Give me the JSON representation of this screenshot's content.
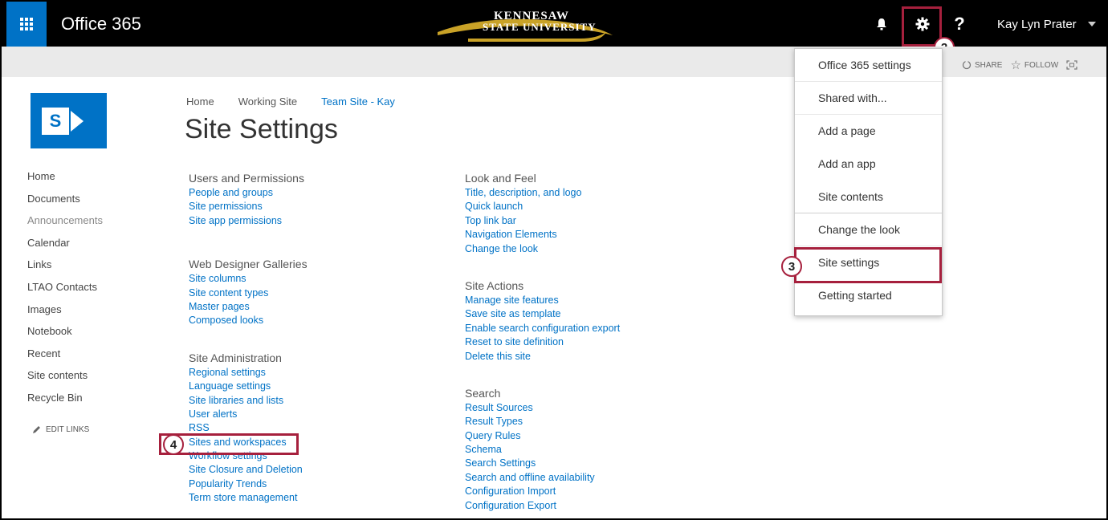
{
  "suitebar": {
    "brand": "Office 365",
    "logo_line1": "KENNESAW",
    "logo_line2": "STATE UNIVERSITY",
    "user_name": "Kay Lyn Prater"
  },
  "subbar": {
    "share": "SHARE",
    "follow": "FOLLOW"
  },
  "breadcrumb": [
    "Home",
    "Working Site",
    "Team Site - Kay"
  ],
  "page_title": "Site Settings",
  "leftnav": {
    "items": [
      "Home",
      "Documents",
      "Announcements",
      "Calendar",
      "Links",
      "LTAO Contacts",
      "Images",
      "Notebook",
      "Recent",
      "Site contents",
      "Recycle Bin"
    ],
    "edit_links": "EDIT LINKS"
  },
  "col1": {
    "users": {
      "heading": "Users and Permissions",
      "links": [
        "People and groups",
        "Site permissions",
        "Site app permissions"
      ]
    },
    "galleries": {
      "heading": "Web Designer Galleries",
      "links": [
        "Site columns",
        "Site content types",
        "Master pages",
        "Composed looks"
      ]
    },
    "admin": {
      "heading": "Site Administration",
      "links": [
        "Regional settings",
        "Language settings",
        "Site libraries and lists",
        "User alerts",
        "RSS",
        "Sites and workspaces",
        "Workflow settings",
        "Site Closure and Deletion",
        "Popularity Trends",
        "Term store management"
      ]
    }
  },
  "col2": {
    "look": {
      "heading": "Look and Feel",
      "links": [
        "Title, description, and logo",
        "Quick launch",
        "Top link bar",
        "Navigation Elements",
        "Change the look"
      ]
    },
    "actions": {
      "heading": "Site Actions",
      "links": [
        "Manage site features",
        "Save site as template",
        "Enable search configuration export",
        "Reset to site definition",
        "Delete this site"
      ]
    },
    "search": {
      "heading": "Search",
      "links": [
        "Result Sources",
        "Result Types",
        "Query Rules",
        "Schema",
        "Search Settings",
        "Search and offline availability",
        "Configuration Import",
        "Configuration Export"
      ]
    }
  },
  "menu": {
    "items": [
      "Office 365 settings",
      "Shared with...",
      "Add a page",
      "Add an app",
      "Site contents",
      "Change the look",
      "Site settings",
      "Getting started"
    ]
  },
  "callouts": [
    "2",
    "3",
    "4"
  ],
  "colors": {
    "accent": "#0072c6",
    "highlight": "#a6203d",
    "suitebar": "#000000"
  }
}
